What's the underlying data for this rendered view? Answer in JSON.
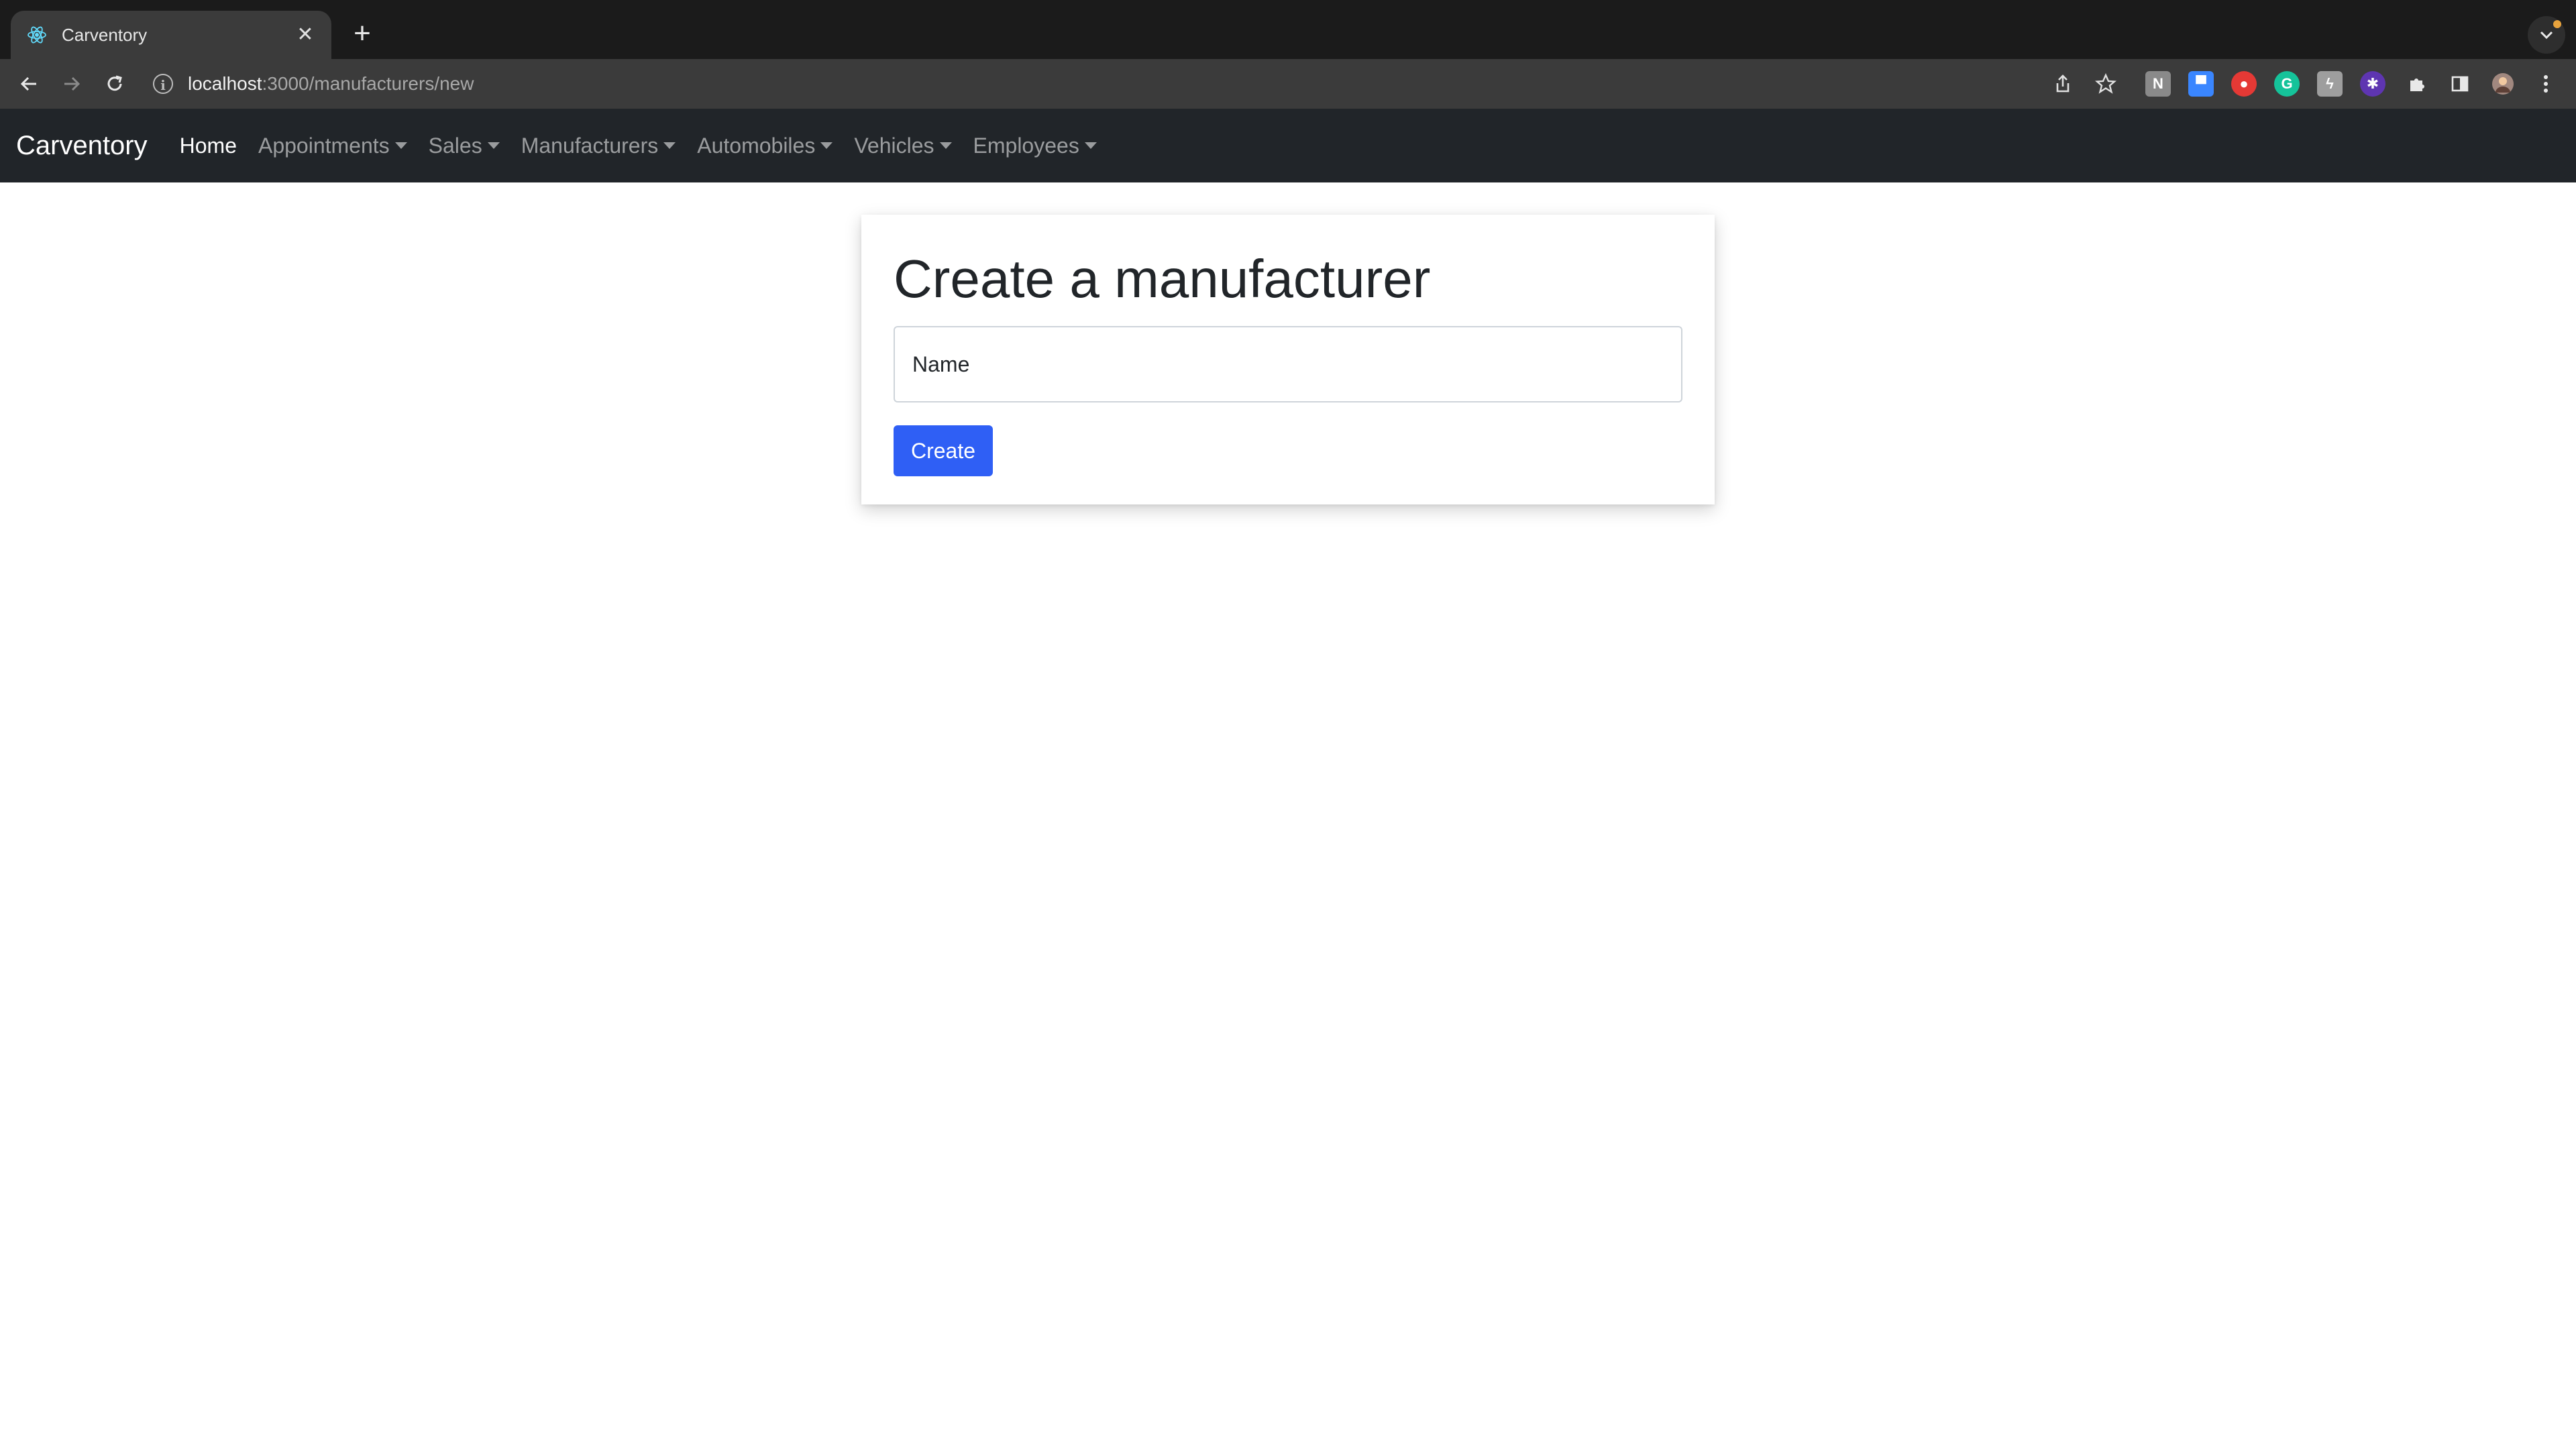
{
  "browser": {
    "tab_title": "Carventory",
    "url_host": "localhost",
    "url_path": ":3000/manufacturers/new",
    "extensions": [
      "grid-ext-icon",
      "window-ext-icon",
      "red-ext-icon",
      "grammarly-icon",
      "lightning-ext-icon",
      "color-ext-icon",
      "puzzle-icon",
      "sidebar-icon",
      "profile-avatar"
    ]
  },
  "navbar": {
    "brand": "Carventory",
    "items": [
      {
        "label": "Home",
        "active": true,
        "dropdown": false
      },
      {
        "label": "Appointments",
        "active": false,
        "dropdown": true
      },
      {
        "label": "Sales",
        "active": false,
        "dropdown": true
      },
      {
        "label": "Manufacturers",
        "active": false,
        "dropdown": true
      },
      {
        "label": "Automobiles",
        "active": false,
        "dropdown": true
      },
      {
        "label": "Vehicles",
        "active": false,
        "dropdown": true
      },
      {
        "label": "Employees",
        "active": false,
        "dropdown": true
      }
    ]
  },
  "form": {
    "title": "Create a manufacturer",
    "name_placeholder": "Name",
    "submit_label": "Create"
  },
  "colors": {
    "navbar_bg": "#212529",
    "primary": "#2f5ff5"
  }
}
